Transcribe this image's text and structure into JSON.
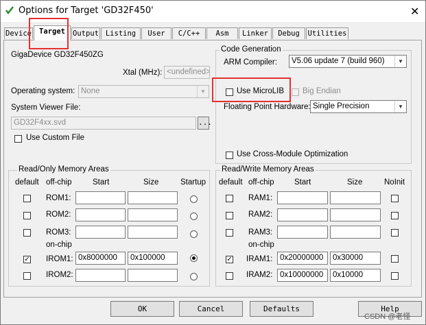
{
  "window": {
    "title": "Options for Target 'GD32F450'",
    "close_glyph": "✕"
  },
  "tabs": [
    "Device",
    "Target",
    "Output",
    "Listing",
    "User",
    "C/C++",
    "Asm",
    "Linker",
    "Debug",
    "Utilities"
  ],
  "device": {
    "name": "GigaDevice GD32F450ZG",
    "xtal_label": "Xtal (MHz):",
    "xtal_value": "<undefined>",
    "os_label": "Operating system:",
    "os_value": "None",
    "svd_label": "System Viewer File:",
    "svd_value": "GD32F4xx.svd",
    "svd_browse": "...",
    "custom_file_label": "Use Custom File"
  },
  "codegen": {
    "group_label": "Code Generation",
    "compiler_label": "ARM Compiler:",
    "compiler_value": "V5.06 update 7 (build 960)",
    "microlib_label": "Use MicroLIB",
    "big_endian_label": "Big Endian",
    "fpu_label": "Floating Point Hardware:",
    "fpu_value": "Single Precision",
    "cross_module_label": "Use Cross-Module Optimization"
  },
  "rom": {
    "group_label": "Read/Only Memory Areas",
    "headers": {
      "default": "default",
      "offchip": "off-chip",
      "start": "Start",
      "size": "Size",
      "startup": "Startup"
    },
    "onchip_label": "on-chip",
    "rows": [
      {
        "label": "ROM1:",
        "start": "",
        "size": "",
        "default": false,
        "startup": false
      },
      {
        "label": "ROM2:",
        "start": "",
        "size": "",
        "default": false,
        "startup": false
      },
      {
        "label": "ROM3:",
        "start": "",
        "size": "",
        "default": false,
        "startup": false
      },
      {
        "label": "IROM1:",
        "start": "0x8000000",
        "size": "0x100000",
        "default": true,
        "startup": true
      },
      {
        "label": "IROM2:",
        "start": "",
        "size": "",
        "default": false,
        "startup": false
      }
    ]
  },
  "ram": {
    "group_label": "Read/Write Memory Areas",
    "headers": {
      "default": "default",
      "offchip": "off-chip",
      "start": "Start",
      "size": "Size",
      "noinit": "NoInit"
    },
    "onchip_label": "on-chip",
    "rows": [
      {
        "label": "RAM1:",
        "start": "",
        "size": "",
        "default": false,
        "noinit": false
      },
      {
        "label": "RAM2:",
        "start": "",
        "size": "",
        "default": false,
        "noinit": false
      },
      {
        "label": "RAM3:",
        "start": "",
        "size": "",
        "default": false,
        "noinit": false
      },
      {
        "label": "IRAM1:",
        "start": "0x20000000",
        "size": "0x30000",
        "default": true,
        "noinit": false
      },
      {
        "label": "IRAM2:",
        "start": "0x10000000",
        "size": "0x10000",
        "default": false,
        "noinit": false
      }
    ]
  },
  "buttons": {
    "ok": "OK",
    "cancel": "Cancel",
    "defaults": "Defaults",
    "help": "Help"
  },
  "watermark": "CSDN @老怪",
  "colors": {
    "highlight": "#e5302f",
    "icon_green": "#2e8b2e"
  }
}
